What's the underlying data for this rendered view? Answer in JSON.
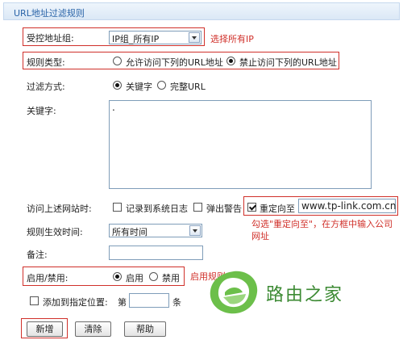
{
  "header": {
    "title": "URL地址过滤规则"
  },
  "form": {
    "host_group": {
      "label": "受控地址组:",
      "value": "IP组_所有IP",
      "annotation": "选择所有IP"
    },
    "rule_type": {
      "label": "规则类型:",
      "option_allow": "允许访问下列的URL地址",
      "option_block": "禁止访问下列的URL地址",
      "selected": "block"
    },
    "filter_method": {
      "label": "过滤方式:",
      "option_keyword": "关键字",
      "option_full_url": "完整URL",
      "selected": "keyword"
    },
    "keyword": {
      "label": "关键字:",
      "value": "."
    },
    "visit_action": {
      "label": "访问上述网站时:",
      "log_label": "记录到系统日志",
      "log_checked": false,
      "alert_label": "弹出警告",
      "alert_checked": false,
      "redirect_label": "重定向至",
      "redirect_checked": true,
      "redirect_url": "www.tp-link.com.cn",
      "annotation": "勾选\"重定向至\"，在方框中输入公司网址"
    },
    "effective_time": {
      "label": "规则生效时间:",
      "value": "所有时间"
    },
    "remark": {
      "label": "备注:",
      "value": ""
    },
    "enable": {
      "label": "启用/禁用:",
      "option_enable": "启用",
      "option_disable": "禁用",
      "selected": "enable",
      "annotation": "启用规则"
    },
    "position": {
      "label": "添加到指定位置:",
      "checked": false,
      "prefix": "第",
      "value": "",
      "suffix": "条"
    }
  },
  "buttons": {
    "add": "新增",
    "clear": "清除",
    "help": "帮助"
  },
  "watermark": {
    "text": "路由之家",
    "color": "#3c8a33"
  }
}
